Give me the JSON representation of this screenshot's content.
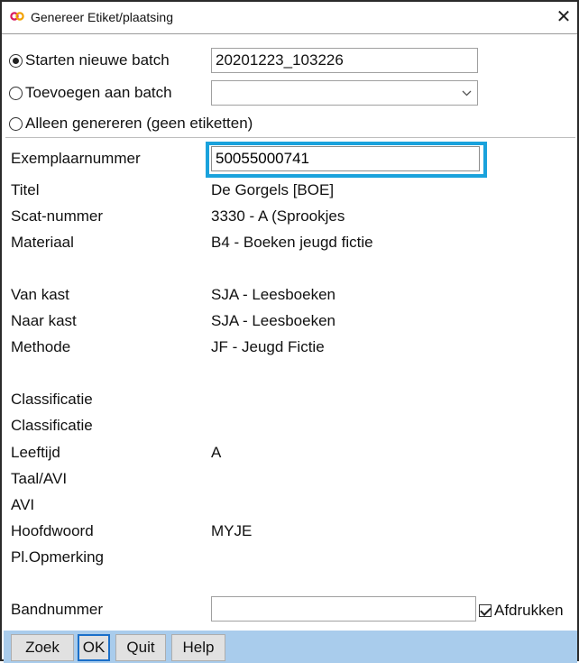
{
  "window": {
    "title": "Genereer Etiket/plaatsing",
    "close_glyph": "✕",
    "icon": "app-logo-icon"
  },
  "batch": {
    "start_label": "Starten nieuwe batch",
    "start_value": "20201223_103226",
    "append_label": "Toevoegen aan batch",
    "append_value": "",
    "generate_only_label": "Alleen genereren (geen etiketten)",
    "selected": "start"
  },
  "fields": {
    "exemplaar_label": "Exemplaarnummer",
    "exemplaar_value": "50055000741",
    "titel_label": "Titel",
    "titel_value": "De Gorgels [BOE]",
    "scat_label": "Scat-nummer",
    "scat_value": "3330 - A (Sprookjes",
    "materiaal_label": "Materiaal",
    "materiaal_value": "B4 - Boeken jeugd fictie",
    "van_kast_label": "Van kast",
    "van_kast_value": "SJA - Leesboeken",
    "naar_kast_label": "Naar kast",
    "naar_kast_value": "SJA - Leesboeken",
    "methode_label": "Methode",
    "methode_value": "JF - Jeugd Fictie",
    "classificatie1_label": "Classificatie",
    "classificatie2_label": "Classificatie",
    "leeftijd_label": "Leeftijd",
    "leeftijd_value": "A",
    "taal_avi_label": "Taal/AVI",
    "avi_label": "AVI",
    "hoofdwoord_label": "Hoofdwoord",
    "hoofdwoord_value": "MYJE",
    "pl_opmerking_label": "Pl.Opmerking",
    "bandnummer_label": "Bandnummer",
    "bandnummer_value": ""
  },
  "afdrukken": {
    "label": "Afdrukken",
    "checked": true
  },
  "toolbar": {
    "zoek": "Zoek",
    "ok": "OK",
    "quit": "Quit",
    "help": "Help"
  },
  "colors": {
    "highlight": "#1aa2dc",
    "toolbar_bg": "#a9ccec"
  }
}
